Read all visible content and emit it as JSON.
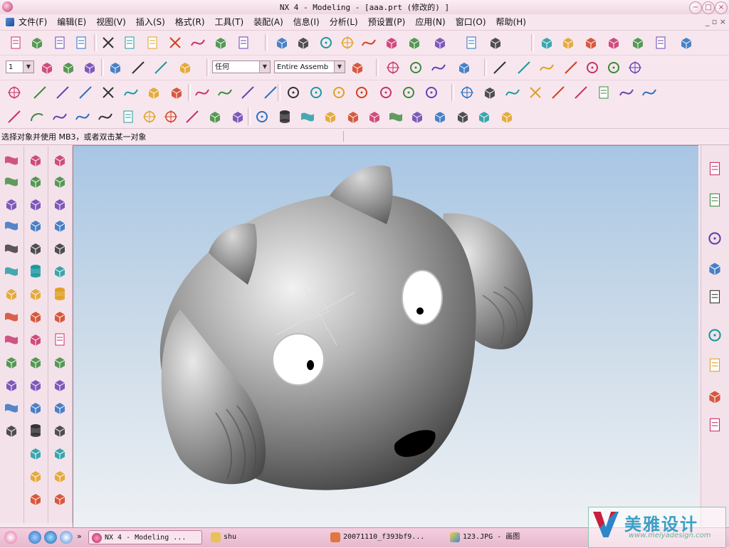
{
  "window": {
    "title": "NX 4 - Modeling - [aaa.prt (修改的) ]",
    "min_label": "−",
    "max_label": "□",
    "close_label": "×"
  },
  "menu": {
    "items": [
      "文件(F)",
      "编辑(E)",
      "视图(V)",
      "插入(S)",
      "格式(R)",
      "工具(T)",
      "装配(A)",
      "信息(I)",
      "分析(L)",
      "预设置(P)",
      "应用(N)",
      "窗口(O)",
      "帮助(H)"
    ],
    "doc_controls": "_ ▫ ×"
  },
  "toolbar2": {
    "layer_value": "1",
    "filter_value": "任何",
    "assembly_value": "Entire Assemb"
  },
  "statusline": {
    "prompt": "选择对象并使用 MB3，或者双击某一对象"
  },
  "taskbar": {
    "tasks": [
      {
        "label": "NX 4 - Modeling ...",
        "active": true
      },
      {
        "label": "shu",
        "active": false
      },
      {
        "label": "20071110_f393bf9...",
        "active": false
      },
      {
        "label": "123.JPG - 画图",
        "active": false
      }
    ],
    "more": "»"
  },
  "watermark": {
    "brand": "美雅设计",
    "url": "www.meiyadesign.com"
  },
  "icons": {
    "toolbar1": [
      "new-icon",
      "open-icon",
      "save-icon",
      "print-icon",
      "cut-icon",
      "copy-icon",
      "paste-icon",
      "delete-icon",
      "undo-icon",
      "repeat-icon",
      "info-icon",
      "fit-icon",
      "zoom-window-icon",
      "zoom-icon",
      "zoom-in-out-icon",
      "rotate-icon",
      "pan-icon",
      "render-style-icon",
      "view-orientation-icon",
      "layer-icon",
      "drafting-icon",
      "gateway-icon",
      "assembly-icon",
      "cam-icon",
      "shape-studio-icon",
      "sheet-metal-icon",
      "routing-icon",
      "application-icon"
    ],
    "resource_bar": [
      "assembly-navigator-icon",
      "part-navigator-icon",
      "web-browser-icon",
      "training-icon",
      "help-icon",
      "history-icon",
      "system-materials-icon",
      "reuse-library-icon",
      "roles-icon"
    ]
  },
  "colors": {
    "accent": "#c8306a",
    "ui_background": "#f7e6ee",
    "viewport_top": "#a8c6e4",
    "viewport_bottom": "#eef1f4",
    "model_gray": "#8c8c8c"
  }
}
